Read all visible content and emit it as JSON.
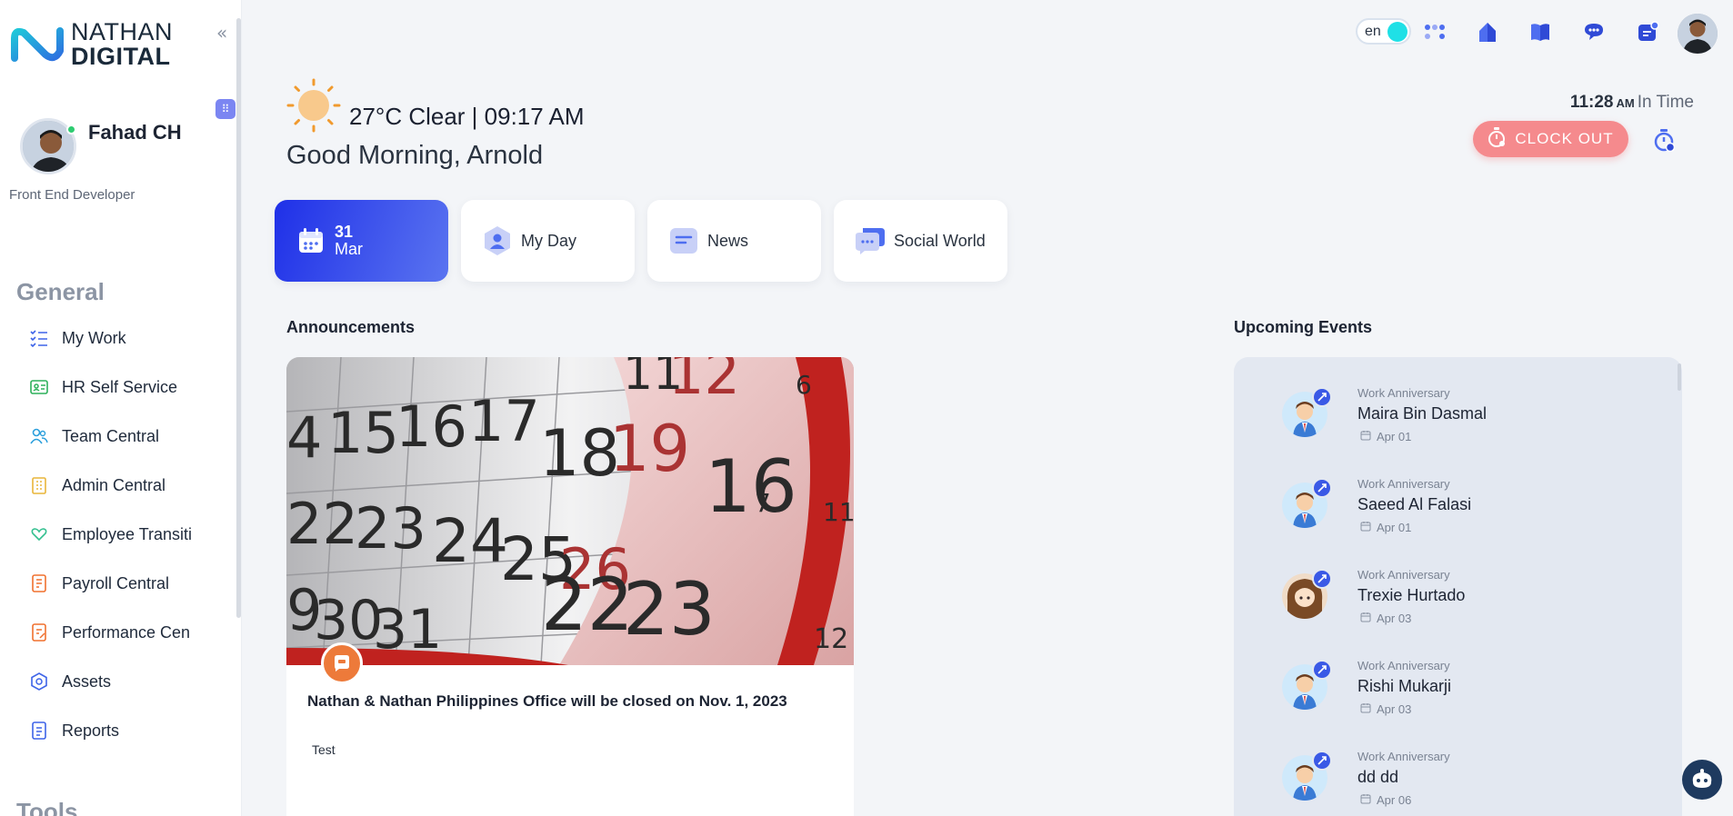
{
  "brand": {
    "line1": "NATHAN",
    "line2": "DIGITAL"
  },
  "profile": {
    "name": "Fahad CH",
    "role": "Front End Developer"
  },
  "sidebar": {
    "section_general": "General",
    "section_tools": "Tools",
    "items": [
      {
        "label": "My Work",
        "icon": "checklist-icon"
      },
      {
        "label": "HR Self Service",
        "icon": "id-card-icon"
      },
      {
        "label": "Team Central",
        "icon": "people-icon"
      },
      {
        "label": "Admin Central",
        "icon": "building-icon"
      },
      {
        "label": "Employee Transiti",
        "icon": "heart-hand-icon"
      },
      {
        "label": "Payroll Central",
        "icon": "payroll-doc-icon"
      },
      {
        "label": "Performance Cen",
        "icon": "performance-doc-icon"
      },
      {
        "label": "Assets",
        "icon": "hexagon-icon"
      },
      {
        "label": "Reports",
        "icon": "report-icon"
      }
    ]
  },
  "topbar": {
    "language": "en"
  },
  "weather": {
    "summary": "27°C Clear | 09:17 AM"
  },
  "greeting": "Good Morning, Arnold",
  "attendance": {
    "time": "11:28",
    "ampm": "AM",
    "label": "In Time",
    "clockout_label": "CLOCK OUT"
  },
  "tabs": {
    "date_day": "31",
    "date_month": "Mar",
    "my_day": "My Day",
    "news": "News",
    "social": "Social World"
  },
  "announcements": {
    "heading": "Announcements",
    "title": "Nathan & Nathan Philippines Office will be closed on Nov. 1, 2023",
    "body": "Test"
  },
  "events": {
    "heading": "Upcoming Events",
    "items": [
      {
        "type": "Work Anniversary",
        "name": "Maira Bin Dasmal",
        "date": "Apr 01"
      },
      {
        "type": "Work Anniversary",
        "name": "Saeed Al Falasi",
        "date": "Apr 01"
      },
      {
        "type": "Work Anniversary",
        "name": "Trexie Hurtado",
        "date": "Apr 03"
      },
      {
        "type": "Work Anniversary",
        "name": "Rishi Mukarji",
        "date": "Apr 03"
      },
      {
        "type": "Work Anniversary",
        "name": "dd dd",
        "date": "Apr 06"
      }
    ]
  },
  "colors": {
    "accent": "#2f45ea",
    "clockout": "#f58a8d",
    "events_bg": "#e3e8f1"
  }
}
